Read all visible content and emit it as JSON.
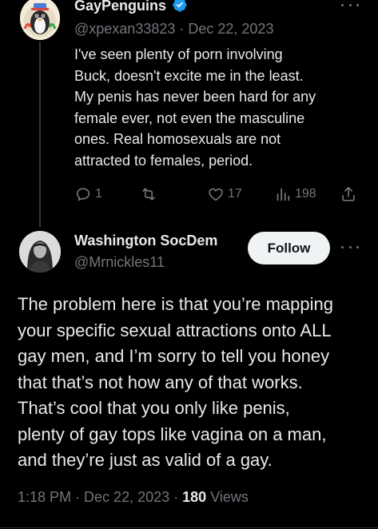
{
  "tweet1": {
    "author_name": "GayPenguins",
    "verified_icon": "verified-badge-icon",
    "handle": "@xpexan33823",
    "date": "Dec 22, 2023",
    "separator": " · ",
    "text": "I've seen plenty of porn involving\nBuck, doesn't excite me in the least.\nMy penis has never been hard for any\nfemale ever, not even the masculine\nones. Real homosexuals are not\nattracted to females, period.",
    "actions": {
      "reply": {
        "icon": "reply-icon",
        "count": "1"
      },
      "repost": {
        "icon": "repost-icon",
        "count": ""
      },
      "like": {
        "icon": "heart-icon",
        "count": "17"
      },
      "views": {
        "icon": "views-icon",
        "count": "198"
      },
      "share": {
        "icon": "share-icon"
      }
    }
  },
  "tweet2": {
    "author_name": "Washington SocDem",
    "handle": "@Mrnickles11",
    "follow_label": "Follow",
    "text": "The problem here is that you’re mapping\nyour specific sexual attractions onto ALL\ngay men, and I’m sorry to tell you honey\nthat that’s not how any of that works.\nThat’s cool that you only like penis,\nplenty of gay tops like vagina on a man,\nand they’re just as valid of a gay.",
    "time": "1:18 PM",
    "date": "Dec 22, 2023",
    "views_count": "180",
    "views_label": "Views",
    "separator": " · "
  },
  "colors": {
    "background": "#000000",
    "text_primary": "#e7e9ea",
    "text_secondary": "#71767b",
    "verified": "#1d9bf0",
    "follow_bg": "#eff3f4"
  }
}
